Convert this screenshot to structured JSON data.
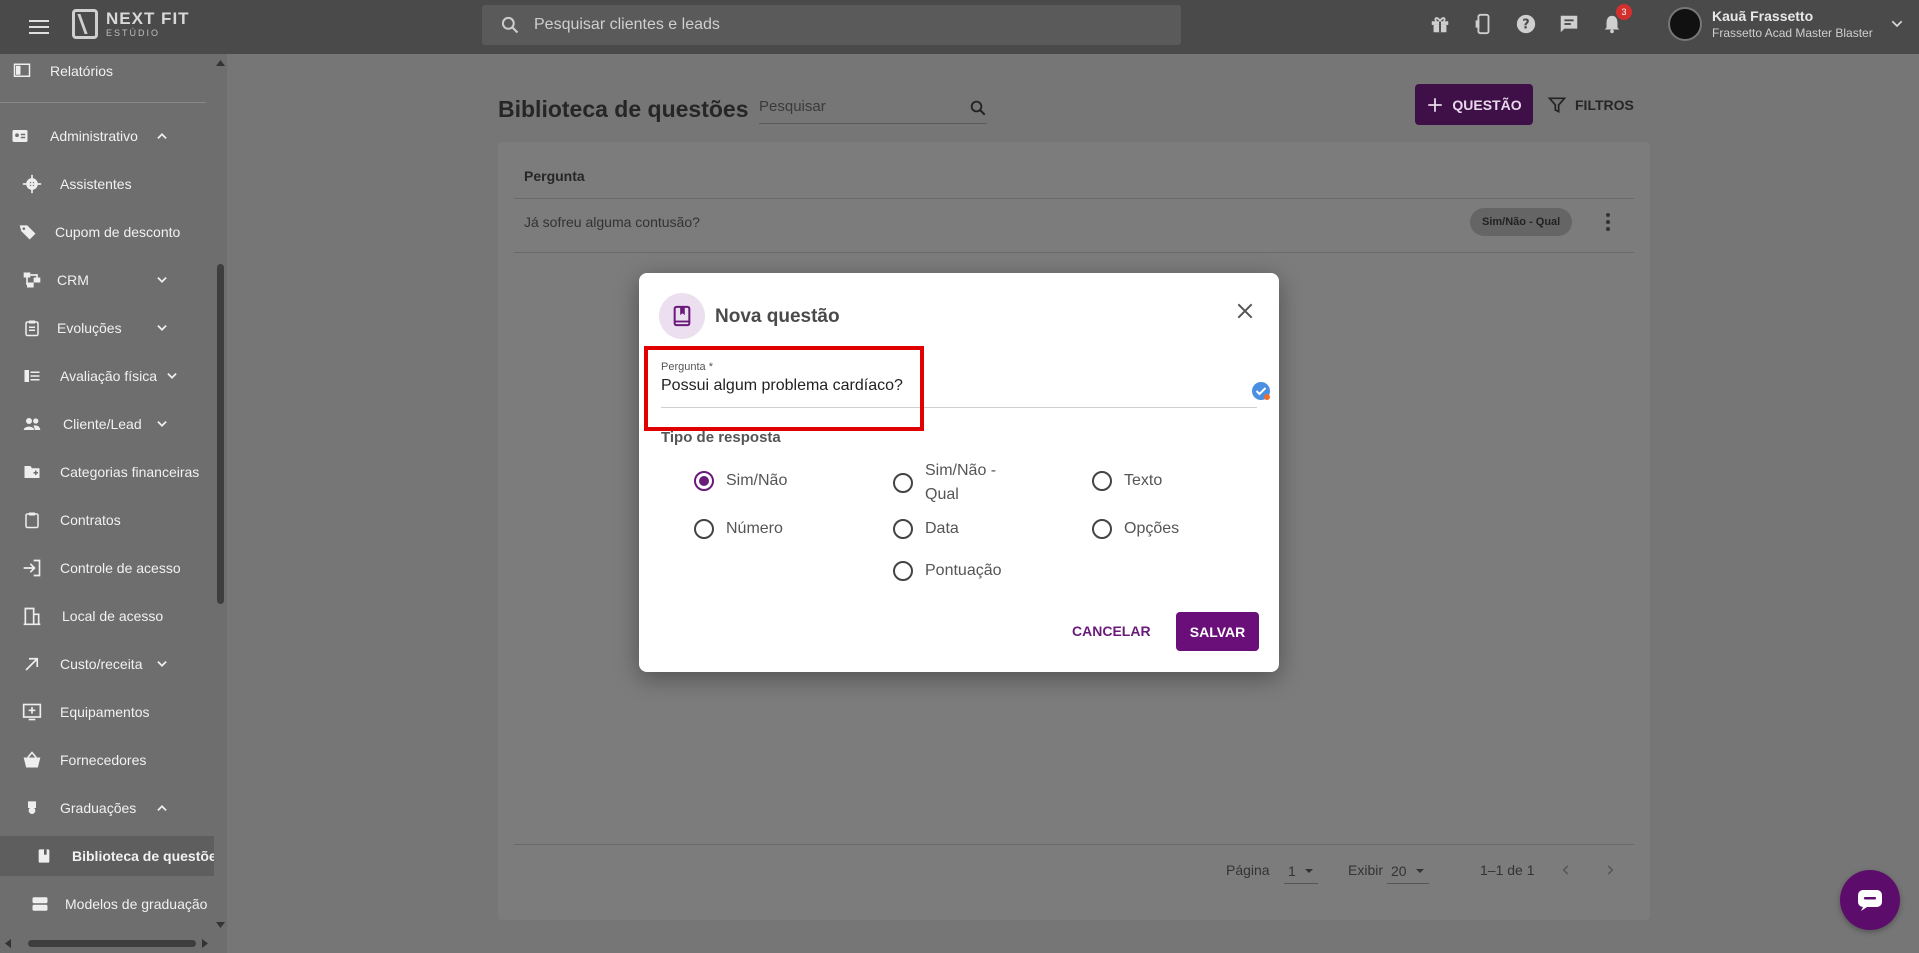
{
  "topbar": {
    "logo_title": "NEXT FIT",
    "logo_sub": "ESTÚDIO",
    "search_placeholder": "Pesquisar clientes e leads",
    "notifications_count": "3",
    "user_name": "Kauã Frassetto",
    "user_org": "Frassetto Acad Master Blaster"
  },
  "sidebar": {
    "items": [
      {
        "label": "Relatórios",
        "icon": "report-icon"
      },
      {
        "label": "Administrativo",
        "icon": "admin-card-icon",
        "expanded": true
      },
      {
        "label": "Assistentes",
        "icon": "gear-icon"
      },
      {
        "label": "Cupom de desconto",
        "icon": "tag-icon"
      },
      {
        "label": "CRM",
        "icon": "crm-icon"
      },
      {
        "label": "Evoluções",
        "icon": "clipboard-icon"
      },
      {
        "label": "Avaliação física",
        "icon": "bars-icon"
      },
      {
        "label": "Cliente/Lead",
        "icon": "people-icon"
      },
      {
        "label": "Categorias financeiras",
        "icon": "folder-plus-icon"
      },
      {
        "label": "Contratos",
        "icon": "contract-icon"
      },
      {
        "label": "Controle de acesso",
        "icon": "login-icon"
      },
      {
        "label": "Local de acesso",
        "icon": "building-icon"
      },
      {
        "label": "Custo/receita",
        "icon": "arrow-icon"
      },
      {
        "label": "Equipamentos",
        "icon": "equipment-icon"
      },
      {
        "label": "Fornecedores",
        "icon": "basket-icon"
      },
      {
        "label": "Graduações",
        "icon": "medal-icon",
        "expanded": true
      },
      {
        "label": "Biblioteca de questões",
        "icon": "book-icon",
        "active": true
      },
      {
        "label": "Modelos de graduação",
        "icon": "template-icon"
      }
    ]
  },
  "page": {
    "title": "Biblioteca de questões",
    "search_placeholder": "Pesquisar",
    "add_button": "QUESTÃO",
    "filter_button": "FILTROS",
    "table_header": "Pergunta",
    "rows": [
      {
        "question": "Já sofreu alguma contusão?",
        "type": "Sim/Não - Qual"
      }
    ],
    "pager": {
      "page_label": "Página",
      "page_value": "1",
      "show_label": "Exibir",
      "show_value": "20",
      "range": "1–1 de 1"
    }
  },
  "modal": {
    "title": "Nova questão",
    "field_label": "Pergunta *",
    "field_value": "Possui algum problema cardíaco?",
    "radio_group_title": "Tipo de resposta",
    "options": [
      {
        "label": "Sim/Não",
        "checked": true
      },
      {
        "label": "Sim/Não - Qual",
        "checked": false
      },
      {
        "label": "Texto",
        "checked": false
      },
      {
        "label": "Número",
        "checked": false
      },
      {
        "label": "Data",
        "checked": false
      },
      {
        "label": "Opções",
        "checked": false
      },
      {
        "label": "Pontuação",
        "checked": false
      }
    ],
    "cancel_label": "CANCELAR",
    "save_label": "SALVAR"
  },
  "colors": {
    "topbar": "#4a4a4a",
    "brand_purple": "#6a0f7a",
    "highlight_red": "#e00000"
  }
}
